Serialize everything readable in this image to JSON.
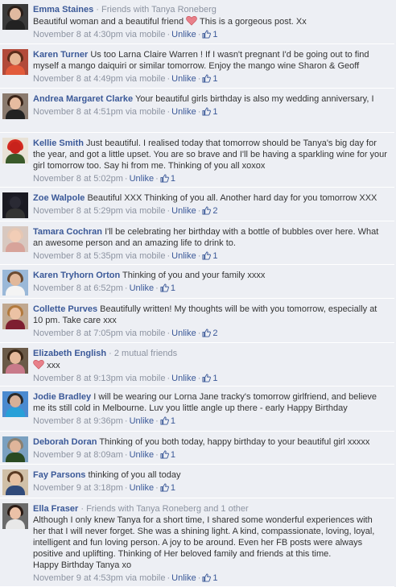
{
  "comments": [
    {
      "name": "Emma Staines",
      "meta": "Friends with Tanya Roneberg",
      "text_before": "Beautiful woman and a beautiful friend",
      "heart": true,
      "text_after": "This is a gorgeous post. Xx",
      "time": "November 8 at 4:30pm via mobile",
      "unlike": "Unlike",
      "likes": "1"
    },
    {
      "name": "Karen Turner",
      "meta": "",
      "text_before": "Us too Larna Claire Warren ! If I wasn't pregnant I'd be going out to find myself a mango daiquiri or similar tomorrow. Enjoy the mango wine Sharon & Geoff",
      "heart": false,
      "text_after": "",
      "time": "November 8 at 4:49pm via mobile",
      "unlike": "Unlike",
      "likes": "1"
    },
    {
      "name": "Andrea Margaret Clarke",
      "meta": "",
      "text_before": "Your beautiful girls birthday is also my wedding anniversary, I",
      "heart": false,
      "text_after": "",
      "time": "November 8 at 4:51pm via mobile",
      "unlike": "Unlike",
      "likes": "1"
    },
    {
      "name": "Kellie Smith",
      "meta": "",
      "text_before": "Just beautiful. I realised today that tomorrow should be Tanya's big day for the year, and got a little upset. You are so brave and I'll be having a sparkling wine for your girl tomorrow too. Say hi from me. Thinking of you all xoxox",
      "heart": false,
      "text_after": "",
      "time": "November 8 at 5:02pm",
      "unlike": "Unlike",
      "likes": "1"
    },
    {
      "name": "Zoe Walpole",
      "meta": "",
      "text_before": "Beautiful XXX Thinking of you all. Another hard day for you tomorrow XXX",
      "heart": false,
      "text_after": "",
      "time": "November 8 at 5:29pm via mobile",
      "unlike": "Unlike",
      "likes": "2"
    },
    {
      "name": "Tamara Cochran",
      "meta": "",
      "text_before": "I'll be celebrating her birthday with a bottle of bubbles over here. What an awesome person and an amazing life to drink to.",
      "heart": false,
      "text_after": "",
      "time": "November 8 at 5:35pm via mobile",
      "unlike": "Unlike",
      "likes": "1"
    },
    {
      "name": "Karen Tryhorn Orton",
      "meta": "",
      "text_before": "Thinking of you and your family xxxx",
      "heart": false,
      "text_after": "",
      "time": "November 8 at 6:52pm",
      "unlike": "Unlike",
      "likes": "1"
    },
    {
      "name": "Collette Purves",
      "meta": "",
      "text_before": "Beautifully written! My thoughts will be with you tomorrow, especially at 10 pm. Take care xxx",
      "heart": false,
      "text_after": "",
      "time": "November 8 at 7:05pm via mobile",
      "unlike": "Unlike",
      "likes": "2"
    },
    {
      "name": "Elizabeth English",
      "meta": "2 mutual friends",
      "text_before": "",
      "heart": true,
      "text_after": "xxx",
      "time": "November 8 at 9:13pm via mobile",
      "unlike": "Unlike",
      "likes": "1"
    },
    {
      "name": "Jodie Bradley",
      "meta": "",
      "text_before": "I will be wearing our Lorna Jane tracky's tomorrow girlfriend, and believe me its still cold in Melbourne. Luv you little angle up there - early Happy Birthday",
      "heart": false,
      "text_after": "",
      "time": "November 8 at 9:36pm",
      "unlike": "Unlike",
      "likes": "1"
    },
    {
      "name": "Deborah Doran",
      "meta": "",
      "text_before": "Thinking of you both today, happy birthday to your beautiful girl xxxxx",
      "heart": false,
      "text_after": "",
      "time": "November 9 at 8:09am",
      "unlike": "Unlike",
      "likes": "1"
    },
    {
      "name": "Fay Parsons",
      "meta": "",
      "text_before": "thinking of you all today",
      "heart": false,
      "text_after": "",
      "time": "November 9 at 3:18pm",
      "unlike": "Unlike",
      "likes": "1"
    },
    {
      "name": "Ella Fraser",
      "meta": "Friends with Tanya Roneberg and 1 other",
      "text_before": "Although I only knew Tanya for a short time, I shared some wonderful experiences with her that I will never forget. She was a shining light. A kind, compassionate, loving, loyal, intelligent and fun loving person. A joy to be around. Even her FB posts were always positive and uplifting. Thinking of Her beloved family and friends at this time.",
      "text_line2": "Happy Birthday Tanya xo",
      "heart": false,
      "text_after": "",
      "time": "November 9 at 4:53pm via mobile",
      "unlike": "Unlike",
      "likes": "1"
    }
  ],
  "colors": {
    "background": "#edeff4",
    "name_link": "#3b5998",
    "meta_gray": "#8c93a1",
    "heart": "#e8808a"
  }
}
